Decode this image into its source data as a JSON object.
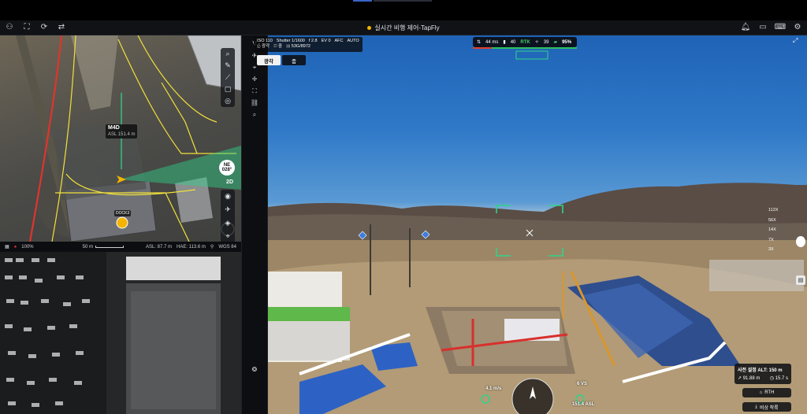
{
  "app": {
    "title": "실시간 비행 제어-TapFly"
  },
  "colors": {
    "accent": "#f5b400",
    "reticle": "#2fd38a",
    "route": "#f2e13a",
    "boundary": "#e0342d",
    "signal_ok": "#2fbf61"
  },
  "map": {
    "drone_label": "M4D",
    "drone_asl": "ASL 151.4 m",
    "dock_label": "DOCK3",
    "compass_dir": "NE",
    "compass_deg": "028°",
    "view_mode": "2D",
    "status": {
      "zoom": "100%",
      "scale": "50 m",
      "asl": "ASL: 87.7 m",
      "hae": "HAE: 113.6 m",
      "datum": "WGS 84"
    }
  },
  "camera": {
    "params": {
      "iso": "ISO 110",
      "shutter": "Shutter 1/1600",
      "fstop": "f 2.8",
      "ev": "EV 0",
      "focus": "AFC",
      "wb": "AUTO",
      "mode1": "광각",
      "mode2": "중",
      "storage": "53G/8972"
    },
    "lens_tabs": [
      "광각",
      "줌"
    ],
    "status_bar": {
      "latency": "44 ms",
      "signal": "40",
      "rtk": "RTK",
      "satellites": "39",
      "battery": "95%"
    },
    "zoom_levels": [
      "112X",
      "56X",
      "14X",
      "7X",
      "3X"
    ],
    "osd": {
      "speed": "4.1 m/s",
      "vs": "6 VS",
      "asl": "151.4 ASL"
    },
    "info_card": {
      "title": "사전 설정 ALT: 150 m",
      "distance": "91.88 m",
      "time": "15.7 s"
    },
    "rth_label": "RTH",
    "emergency_label": "비상 착륙"
  }
}
